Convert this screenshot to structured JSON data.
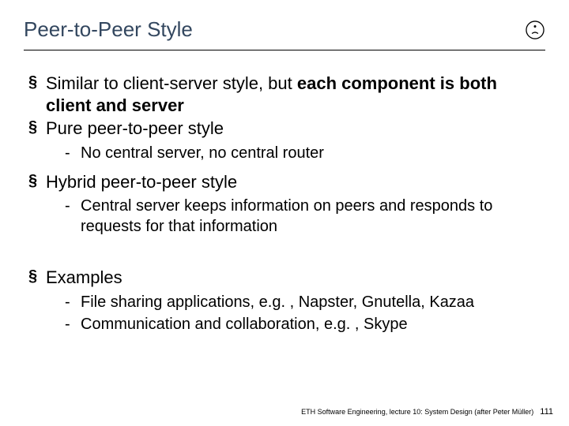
{
  "title": "Peer-to-Peer Style",
  "bullets": {
    "b1_pre": "Similar to client-server style, but ",
    "b1_bold": "each component is both client and server",
    "b2": "Pure peer-to-peer style",
    "b2_s1": "No central server, no central router",
    "b3": "Hybrid peer-to-peer style",
    "b3_s1": "Central server keeps information on peers and responds to requests for that information",
    "b4": "Examples",
    "b4_s1": "File sharing applications, e.g. , Napster, Gnutella, Kazaa",
    "b4_s2": "Communication and collaboration, e.g. , Skype"
  },
  "footer": {
    "text": "ETH Software Engineering, lecture 10: System Design (after Peter Müller)",
    "page": "111"
  }
}
